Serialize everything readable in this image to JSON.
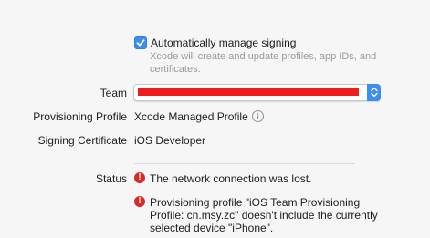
{
  "signing": {
    "auto_manage_label": "Automatically manage signing",
    "auto_manage_checked": true,
    "helper_text": "Xcode will create and update profiles, app IDs, and certificates."
  },
  "team": {
    "label": "Team"
  },
  "provisioning_profile": {
    "label": "Provisioning Profile",
    "value": "Xcode Managed Profile"
  },
  "signing_certificate": {
    "label": "Signing Certificate",
    "value": "iOS Developer"
  },
  "status": {
    "label": "Status",
    "messages": [
      "The network connection was lost.",
      "Provisioning profile \"iOS Team Provisioning Profile: cn.msy.zc\" doesn't include the currently selected device \"iPhone\"."
    ]
  },
  "colors": {
    "accent": "#3d8ef1",
    "error": "#d92a2a",
    "redaction": "#f01d1d"
  }
}
